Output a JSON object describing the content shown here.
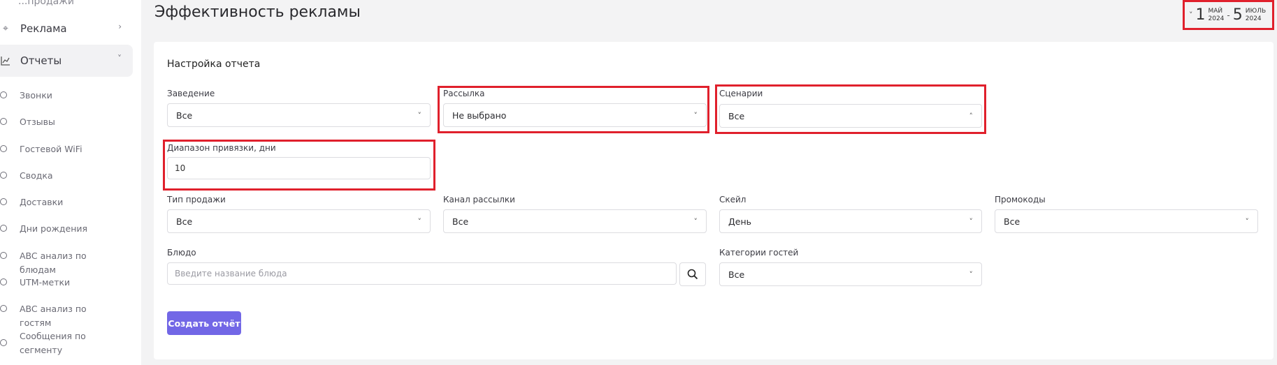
{
  "sidebar": {
    "top_partial": "...продажи",
    "items": [
      {
        "label": "Реклама",
        "icon": "crosshair-icon"
      },
      {
        "label": "Отчеты",
        "icon": "chart-line-icon"
      }
    ],
    "sub_items": [
      "Звонки",
      "Отзывы",
      "Гостевой WiFi",
      "Сводка",
      "Доставки",
      "Дни рождения",
      "ABC анализ по блюдам",
      "UTM-метки",
      "ABC анализ по гостям",
      "Сообщения по сегменту"
    ]
  },
  "header": {
    "title": "Эффективность рекламы",
    "date_range": {
      "start_day": "1",
      "start_month": "МАЙ",
      "start_year": "2024",
      "end_day": "5",
      "end_month": "ИЮЛЬ",
      "end_year": "2024"
    }
  },
  "form": {
    "title": "Настройка отчета",
    "venue": {
      "label": "Заведение",
      "value": "Все"
    },
    "mailing": {
      "label": "Рассылка",
      "value": "Не выбрано"
    },
    "scenarios": {
      "label": "Сценарии",
      "value": "Все"
    },
    "binding_range": {
      "label": "Диапазон привязки, дни",
      "value": "10"
    },
    "sale_type": {
      "label": "Тип продажи",
      "value": "Все"
    },
    "mailing_channel": {
      "label": "Канал рассылки",
      "value": "Все"
    },
    "scale": {
      "label": "Скейл",
      "value": "День"
    },
    "promocodes": {
      "label": "Промокоды",
      "value": "Все"
    },
    "dish": {
      "label": "Блюдо",
      "placeholder": "Введите название блюда"
    },
    "guest_categories": {
      "label": "Категории гостей",
      "value": "Все"
    },
    "submit_label": "Создать отчёт"
  },
  "colors": {
    "accent": "#7267e6",
    "highlight": "#e0202c"
  }
}
